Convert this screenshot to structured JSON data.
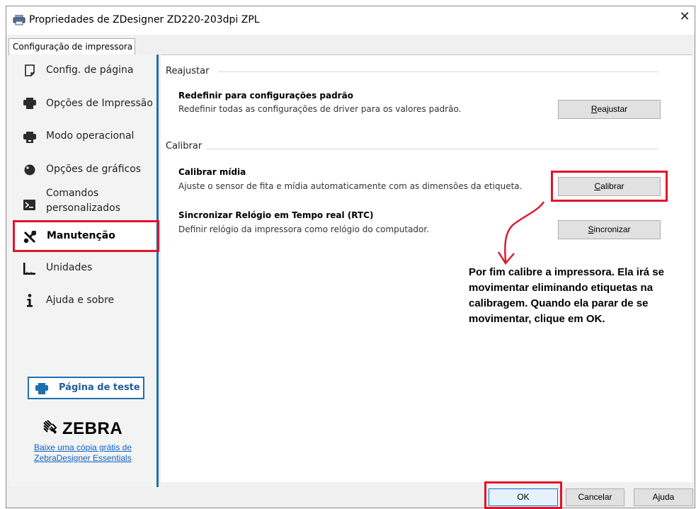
{
  "window": {
    "title": "Propriedades de ZDesigner ZD220-203dpi ZPL",
    "close_glyph": "✕"
  },
  "tab": {
    "label": "Configuração de impressora"
  },
  "sidebar": {
    "items": [
      {
        "label": "Config. de página",
        "icon": "page-icon"
      },
      {
        "label": "Opções de Impressão",
        "icon": "printer-icon"
      },
      {
        "label": "Modo operacional",
        "icon": "printer-mode-icon"
      },
      {
        "label": "Opções de gráficos",
        "icon": "graphics-icon"
      },
      {
        "label_line1": "Comandos",
        "label_line2": "personalizados",
        "icon": "terminal-icon"
      },
      {
        "label": "Manutenção",
        "icon": "tools-icon",
        "selected": true
      },
      {
        "label": "Unidades",
        "icon": "ruler-icon"
      },
      {
        "label": "Ajuda e sobre",
        "icon": "info-icon"
      }
    ],
    "test_page_button": "Página de teste",
    "logo_text": "ZEBRA",
    "download_link_line1": "Baixe uma cópia grátis de",
    "download_link_line2": "ZebraDesigner Essentials"
  },
  "main": {
    "reset_section": {
      "heading": "Reajustar",
      "title": "Redefinir para configurações padrão",
      "description": "Redefinir todas as configurações de driver para os valores padrão.",
      "button_accel": "R",
      "button_rest": "eajustar"
    },
    "calibrate_section": {
      "heading": "Calibrar",
      "calibrate_title": "Calibrar mídia",
      "calibrate_description": "Ajuste o sensor de fita e mídia automaticamente com as dimensões da etiqueta.",
      "calibrate_button_accel": "C",
      "calibrate_button_rest": "alibrar",
      "rtc_title": "Sincronizar Relógio em Tempo real (RTC)",
      "rtc_description": "Definir relógio da impressora como relógio do computador.",
      "sync_button_accel": "S",
      "sync_button_rest": "incronizar"
    },
    "annotation": "Por fim calibre a impressora. Ela irá se movimentar eliminando etiquetas na calibragem. Quando ela parar de se movimentar, clique em OK."
  },
  "footer": {
    "ok": "OK",
    "cancel": "Cancelar",
    "help": "Ajuda"
  },
  "colors": {
    "highlight_red": "#e0142a",
    "accent_blue": "#1f6fb0",
    "link_blue": "#0b62c4"
  }
}
